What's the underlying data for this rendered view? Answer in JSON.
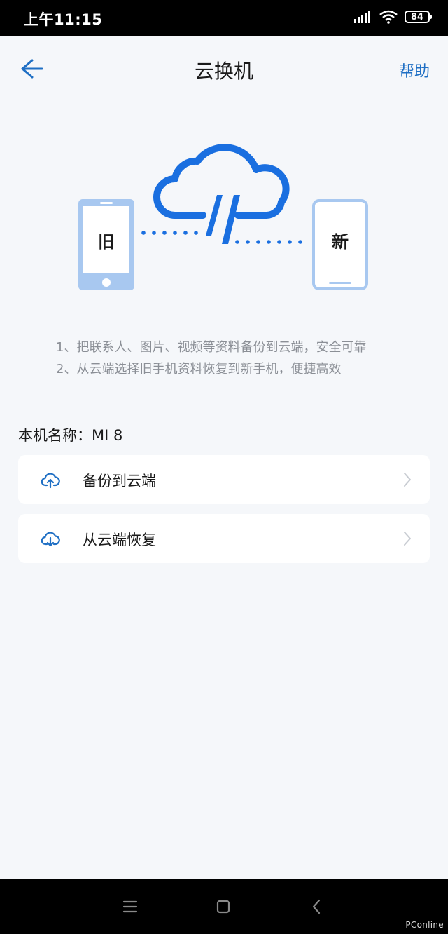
{
  "status_bar": {
    "time": "上午11:15",
    "battery": "84"
  },
  "header": {
    "title": "云换机",
    "help_label": "帮助"
  },
  "illustration": {
    "old_phone_label": "旧",
    "new_phone_label": "新"
  },
  "tips": [
    "1、把联系人、图片、视频等资料备份到云端，安全可靠",
    "2、从云端选择旧手机资料恢复到新手机，便捷高效"
  ],
  "device": {
    "label": "本机名称：MI 8"
  },
  "actions": [
    {
      "label": "备份到云端",
      "icon": "cloud-upload-icon"
    },
    {
      "label": "从云端恢复",
      "icon": "cloud-download-icon"
    }
  ],
  "watermark": "PConline",
  "colors": {
    "accent": "#1f6fc4",
    "illustration_blue": "#1a6fe0",
    "light_blue": "#a8c8f0"
  }
}
